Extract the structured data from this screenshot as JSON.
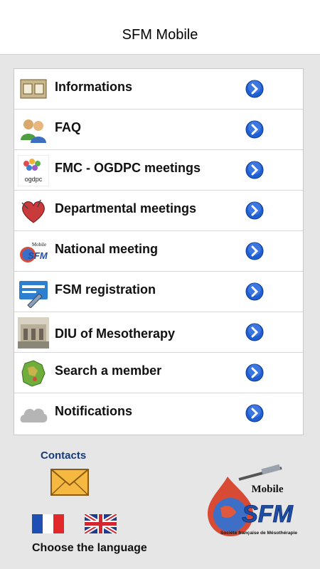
{
  "header": {
    "title": "SFM Mobile"
  },
  "menu": {
    "items": [
      {
        "label": "Informations",
        "icon": "calendar-icon"
      },
      {
        "label": "FAQ",
        "icon": "users-icon"
      },
      {
        "label": "FMC - OGDPC meetings",
        "icon": "ogdpc-logo-icon"
      },
      {
        "label": "Departmental meetings",
        "icon": "heart-icon"
      },
      {
        "label": "National meeting",
        "icon": "sfm-logo-icon"
      },
      {
        "label": "FSM registration",
        "icon": "form-pen-icon"
      },
      {
        "label": "DIU of Mesotherapy",
        "icon": "building-photo-icon"
      },
      {
        "label": "Search a member",
        "icon": "france-map-icon"
      },
      {
        "label": "Notifications",
        "icon": "cloud-icon"
      }
    ]
  },
  "footer": {
    "contacts_label": "Contacts",
    "language_label": "Choose the language",
    "small_logo_text": "ogdpc",
    "logo": {
      "mobile": "Mobile",
      "sfm": "SFM",
      "tagline": "Société française de Mésothérapie"
    }
  },
  "colors": {
    "accent_blue": "#1f5fd1",
    "contacts_blue": "#173b7a"
  }
}
